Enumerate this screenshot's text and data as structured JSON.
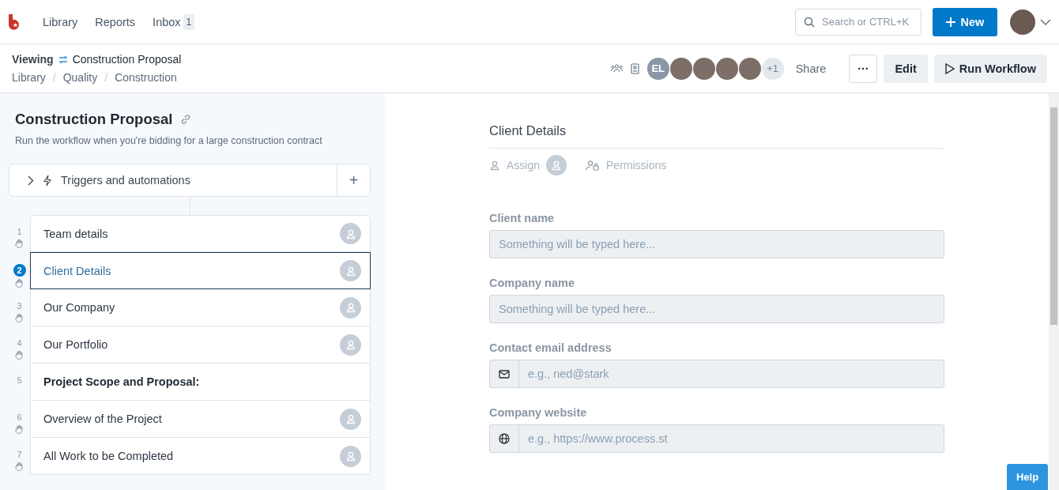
{
  "nav": {
    "items": [
      {
        "label": "Library"
      },
      {
        "label": "Reports"
      },
      {
        "label": "Inbox",
        "badge": "1"
      }
    ],
    "search": {
      "placeholder": "Search or CTRL+K"
    },
    "new_button": "New"
  },
  "header": {
    "mode": "Viewing",
    "title": "Construction Proposal",
    "breadcrumbs": [
      "Library",
      "Quality",
      "Construction"
    ],
    "breadcrumb_separator": "/",
    "avatars": [
      {
        "kind": "initials",
        "text": "EL"
      },
      {
        "kind": "photo"
      },
      {
        "kind": "photo"
      },
      {
        "kind": "photo"
      },
      {
        "kind": "photo"
      },
      {
        "kind": "more",
        "text": "+1"
      }
    ],
    "share": "Share",
    "more": "···",
    "edit": "Edit",
    "run": "Run Workflow"
  },
  "workflow": {
    "title": "Construction Proposal",
    "description": "Run the workflow when you're bidding for a large construction contract",
    "triggers": {
      "label": "Triggers and automations",
      "add": "+"
    },
    "steps": [
      {
        "number": "1",
        "label": "Team details",
        "kind": "task",
        "selected": false
      },
      {
        "number": "2",
        "label": "Client Details",
        "kind": "task",
        "selected": true
      },
      {
        "number": "3",
        "label": "Our Company",
        "kind": "task",
        "selected": false
      },
      {
        "number": "4",
        "label": "Our Portfolio",
        "kind": "task",
        "selected": false
      },
      {
        "number": "5",
        "label": "Project Scope and Proposal:",
        "kind": "heading",
        "selected": false
      },
      {
        "number": "6",
        "label": "Overview of the Project",
        "kind": "task",
        "selected": false
      },
      {
        "number": "7",
        "label": "All Work to be Completed",
        "kind": "task",
        "selected": false
      }
    ]
  },
  "task": {
    "title": "Client Details",
    "assign": "Assign",
    "permissions": "Permissions",
    "fields": [
      {
        "label": "Client name",
        "kind": "text",
        "placeholder": "Something will be typed here..."
      },
      {
        "label": "Company name",
        "kind": "text",
        "placeholder": "Something will be typed here..."
      },
      {
        "label": "Contact email address",
        "kind": "email",
        "placeholder": "e.g., ned@stark"
      },
      {
        "label": "Company website",
        "kind": "url",
        "placeholder": "e.g., https://www.process.st"
      }
    ]
  },
  "help": "Help"
}
